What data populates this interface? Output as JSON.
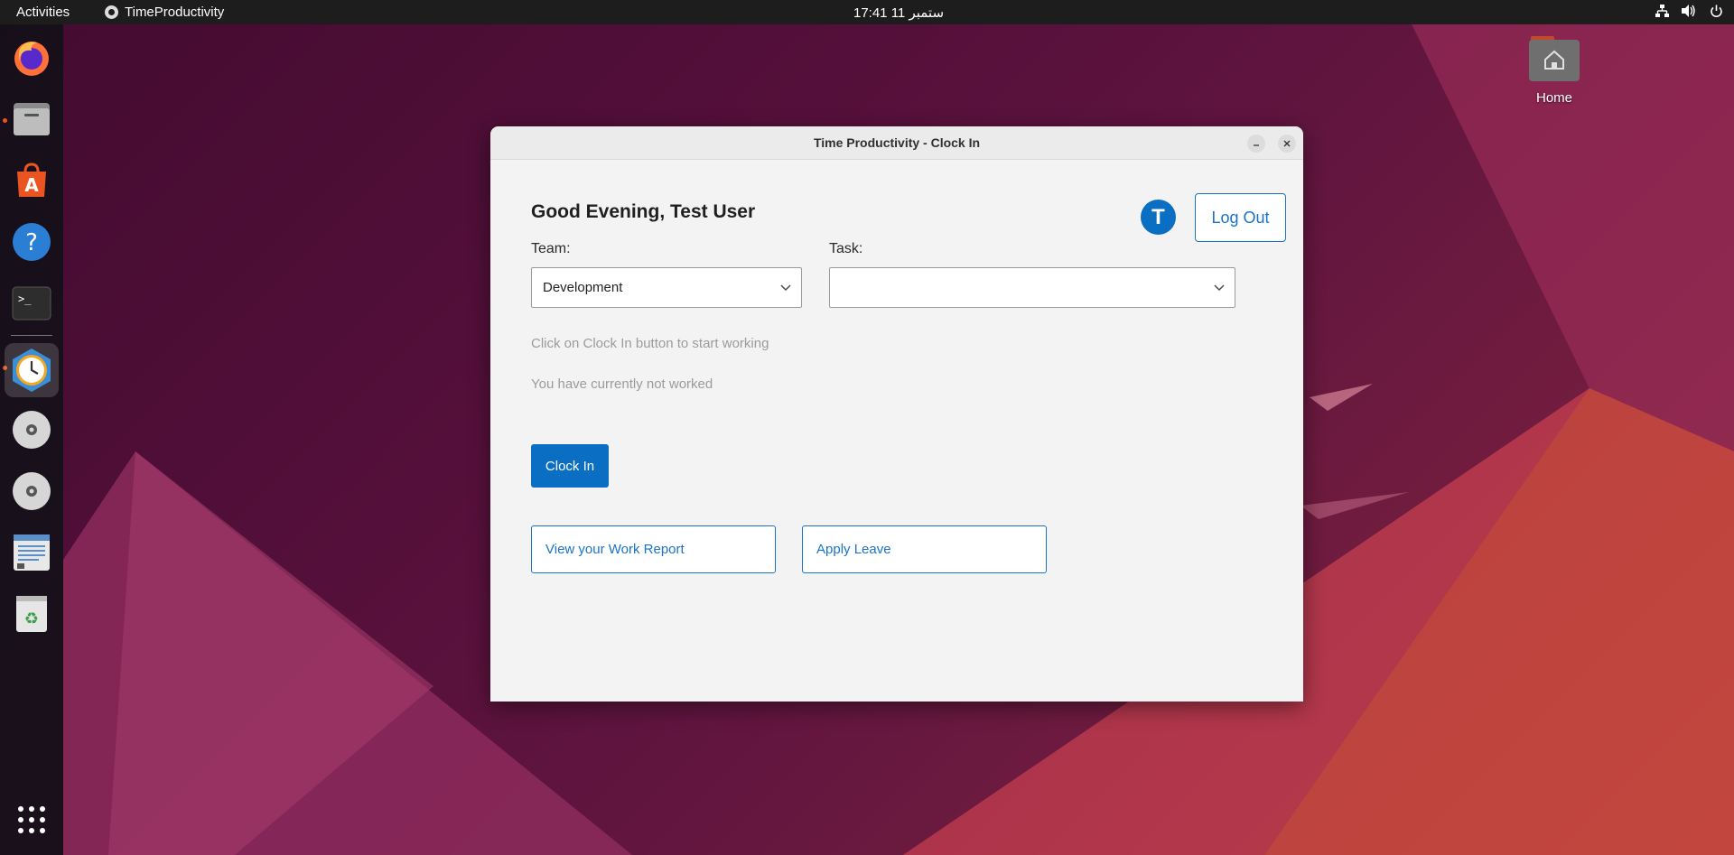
{
  "topbar": {
    "activities": "Activities",
    "app_name": "TimeProductivity",
    "clock": "17:41  11 ستمبر"
  },
  "dock": {
    "items": [
      {
        "name": "firefox-icon"
      },
      {
        "name": "files-icon"
      },
      {
        "name": "app-center-icon"
      },
      {
        "name": "help-icon"
      },
      {
        "name": "terminal-icon"
      },
      {
        "name": "time-productivity-icon"
      },
      {
        "name": "disc-icon"
      },
      {
        "name": "disc-icon"
      },
      {
        "name": "text-editor-icon"
      },
      {
        "name": "trash-icon"
      }
    ],
    "apps_grid": "show-apps-icon"
  },
  "desktop": {
    "home_label": "Home"
  },
  "window": {
    "title": "Time Productivity - Clock In",
    "greeting": "Good Evening, Test User",
    "avatar_letter": "T",
    "logout_label": "Log Out",
    "team_label": "Team:",
    "team_value": "Development",
    "task_label": "Task:",
    "task_value": "",
    "hint_clock_in": "Click on Clock In button to start working",
    "hint_worked": "You have currently not worked",
    "clock_in_label": "Clock In",
    "work_report_label": "View your Work Report",
    "apply_leave_label": "Apply Leave"
  },
  "colors": {
    "accent": "#0a6fc2",
    "topbar": "#1d1d1d",
    "window_bg": "#f3f3f3"
  }
}
